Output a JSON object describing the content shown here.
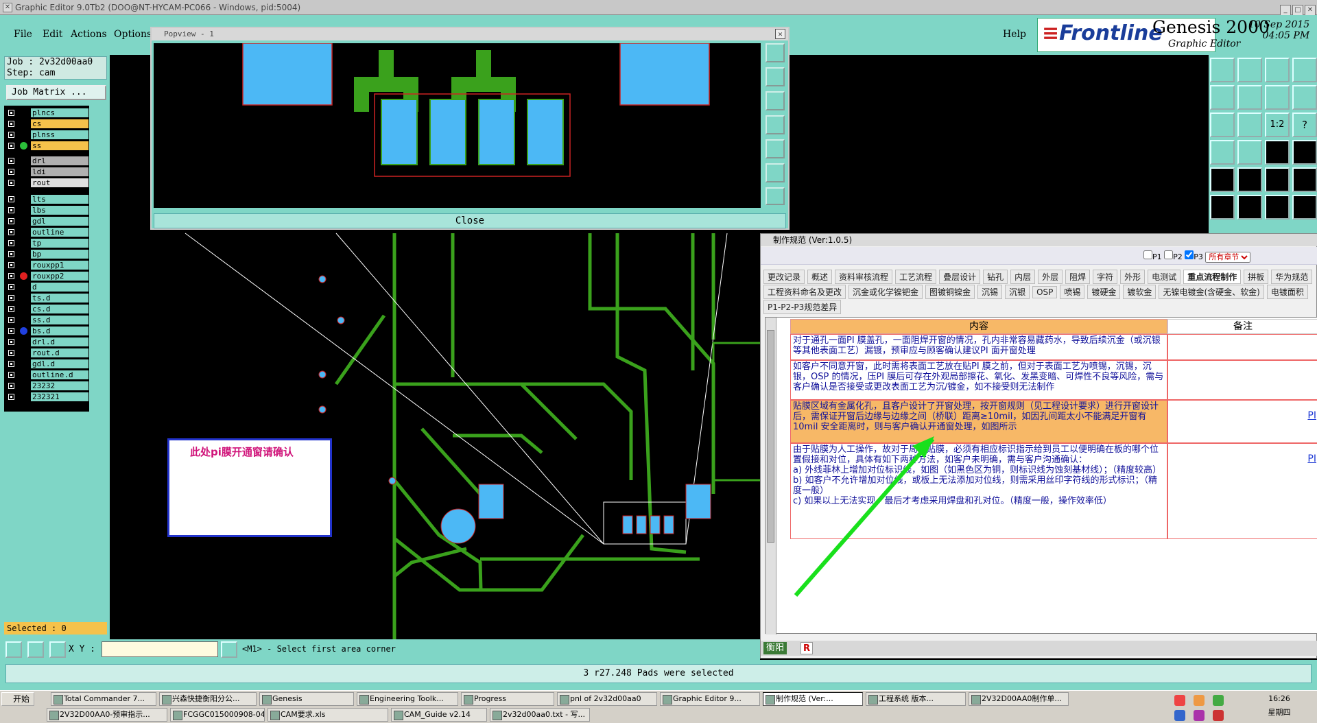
{
  "window": {
    "title": "Graphic Editor 9.0Tb2 (DOO@NT-HYCAM-PC066 - Windows, pid:5004)"
  },
  "menu": [
    "File",
    "Edit",
    "Actions",
    "Options"
  ],
  "help": "Help",
  "brand": {
    "logo": "Frontline",
    "product": "Genesis 2000",
    "sub": "Graphic Editor",
    "date": "10 Sep 2015",
    "time": "04:05 PM"
  },
  "job": {
    "job": "Job : 2v32d00aa0",
    "step": "Step: cam",
    "matrix_button": "Job Matrix ..."
  },
  "layers": [
    {
      "name": "plncs",
      "color": "#7fd6c6",
      "dot": ""
    },
    {
      "name": "cs",
      "color": "#f5c24b",
      "dot": ""
    },
    {
      "name": "plnss",
      "color": "#7fd6c6",
      "dot": ""
    },
    {
      "name": "ss",
      "color": "#f5c24b",
      "dot": "#2bbf3a"
    },
    {
      "name": "drl",
      "color": "#b0b0b0",
      "dot": ""
    },
    {
      "name": "ldi",
      "color": "#b0b0b0",
      "dot": ""
    },
    {
      "name": "rout",
      "color": "#e0e0e0",
      "dot": ""
    },
    {
      "name": "lts",
      "color": "#7fd6c6",
      "dot": ""
    },
    {
      "name": "lbs",
      "color": "#7fd6c6",
      "dot": ""
    },
    {
      "name": "gdl",
      "color": "#7fd6c6",
      "dot": ""
    },
    {
      "name": "outline",
      "color": "#7fd6c6",
      "dot": ""
    },
    {
      "name": "tp",
      "color": "#7fd6c6",
      "dot": ""
    },
    {
      "name": "bp",
      "color": "#7fd6c6",
      "dot": ""
    },
    {
      "name": "rouxpp1",
      "color": "#7fd6c6",
      "dot": ""
    },
    {
      "name": "rouxpp2",
      "color": "#7fd6c6",
      "dot": "#e02020"
    },
    {
      "name": "d",
      "color": "#7fd6c6",
      "dot": ""
    },
    {
      "name": "ts.d",
      "color": "#7fd6c6",
      "dot": ""
    },
    {
      "name": "cs.d",
      "color": "#7fd6c6",
      "dot": ""
    },
    {
      "name": "ss.d",
      "color": "#7fd6c6",
      "dot": ""
    },
    {
      "name": "bs.d",
      "color": "#7fd6c6",
      "dot": "#2040e0"
    },
    {
      "name": "drl.d",
      "color": "#7fd6c6",
      "dot": ""
    },
    {
      "name": "rout.d",
      "color": "#7fd6c6",
      "dot": ""
    },
    {
      "name": "gdl.d",
      "color": "#7fd6c6",
      "dot": ""
    },
    {
      "name": "outline.d",
      "color": "#7fd6c6",
      "dot": ""
    },
    {
      "name": "23232",
      "color": "#7fd6c6",
      "dot": ""
    },
    {
      "name": "232321",
      "color": "#7fd6c6",
      "dot": ""
    }
  ],
  "selected": "Selected : 0",
  "popview": {
    "title": "Popview - 1",
    "close": "Close"
  },
  "annotation": "此处pi膜开通窗请确认",
  "spec": {
    "title": "制作规范 (Ver:1.0.5)",
    "filters": [
      "P1",
      "P2",
      "P3"
    ],
    "section_select": "所有章节",
    "tabs_row1": [
      "更改记录",
      "概述",
      "资料审核流程",
      "工艺流程",
      "叠层设计",
      "钻孔",
      "内层",
      "外层",
      "阻焊",
      "字符",
      "外形",
      "电测试",
      "重点流程制作",
      "拼板",
      "华为规范"
    ],
    "tabs_row2": [
      "工程资料命名及更改",
      "沉金或化学镍钯金",
      "图镀铜镍金",
      "沉锡",
      "沉银",
      "OSP",
      "喷锡",
      "镀硬金",
      "镀软金",
      "无镍电镀金(含硬金、软金)",
      "电镀面积"
    ],
    "tabs_row3": [
      "P1-P2-P3规范差异"
    ],
    "col_content": "内容",
    "col_note": "备注",
    "rows": [
      {
        "text": "对于通孔一面PI 膜盖孔，一面阻焊开窗的情况，孔内非常容易藏药水，导致后续沉金（或沉银等其他表面工艺）漏镀，预审应与顾客确认建议PI 面开窗处理",
        "pi": ""
      },
      {
        "text": "如客户不同意开窗，此时需将表面工艺放在贴PI 膜之前，但对于表面工艺为喷锡，沉锡，沉银，OSP 的情况，压PI 膜后可存在外观局部擦花、氧化、发黑变暗、可焊性不良等风险，需与客户确认是否接受或更改表面工艺为沉/镀金，如不接受则无法制作",
        "pi": ""
      },
      {
        "text": "贴膜区域有金属化孔，且客户设计了开窗处理，按开窗规则（见工程设计要求）进行开窗设计后，需保证开窗后边缘与边缘之间（桥联）距离≥10mil，如因孔间距太小不能满足开窗有10mil 安全距离时，则与客户确认开通窗处理，如图所示",
        "pi": "PI"
      },
      {
        "text": "由于贴膜为人工操作，故对于局部贴膜，必须有相应标识指示给到员工以便明确在板的哪个位置假接和对位，具体有如下两种方法，如客户未明确，需与客户沟通确认：\na) 外线菲林上增加对位标识线，如图（如黑色区为铜，则标识线为蚀刻基材线）；（精度较高）\nb) 如客户不允许增加对位线，或板上无法添加对位线，则需采用丝印字符线的形式标识；（精度一般）\nc) 如果以上无法实现，最后才考虑采用焊盘和孔对位。（精度一般，操作效率低）",
        "pi": "PI"
      }
    ],
    "footer": {
      "label": "衡阳",
      "r": "R"
    }
  },
  "xy": {
    "label": "X Y :",
    "value": ""
  },
  "message": "<M1> - Select first area corner",
  "status": "3 r27.248 Pads were selected",
  "taskbar": {
    "start": "开始",
    "row1": [
      "Total Commander 7...",
      "兴森快捷衡阳分公...",
      "Genesis",
      "Engineering Toolk...",
      "Progress",
      "pnl of 2v32d00aa0",
      "Graphic Editor 9...",
      "制作规范 (Ver:...",
      "工程系统   版本...",
      "2V32D00AA0制作单..."
    ],
    "row2": [
      "2V32D00AA0-预审指示...",
      "FCGGC015000908-04(2...",
      "CAM要求.xls",
      "CAM_Guide v2.14",
      "2v32d00aa0.txt - 写..."
    ],
    "clock": "16:26",
    "weekday": "星期四"
  },
  "colors": {
    "panel": "#7fd6c6",
    "trace": "#3aa11c",
    "pad": "#4cb8f5",
    "outline": "#cc2222",
    "highlight": "#f7b867"
  }
}
